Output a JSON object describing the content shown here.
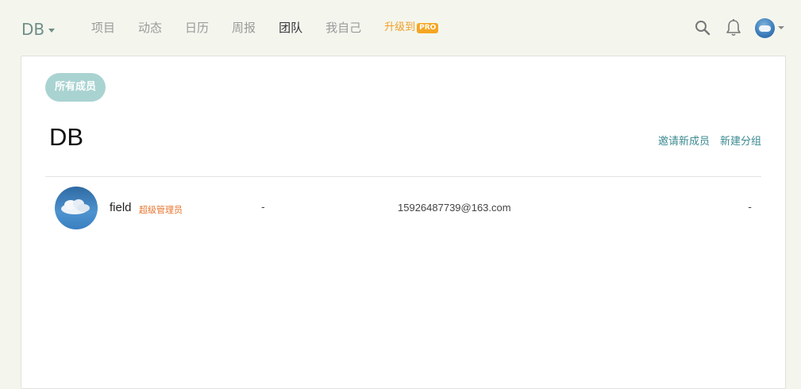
{
  "header": {
    "brand": "DB",
    "nav": [
      {
        "label": "项目",
        "active": false
      },
      {
        "label": "动态",
        "active": false
      },
      {
        "label": "日历",
        "active": false
      },
      {
        "label": "周报",
        "active": false
      },
      {
        "label": "团队",
        "active": true
      },
      {
        "label": "我自己",
        "active": false
      }
    ],
    "upgrade_label": "升级到",
    "pro_badge": "PRO",
    "icons": [
      "search-icon",
      "bell-icon",
      "user-avatar"
    ]
  },
  "team": {
    "filter_chip": "所有成员",
    "title": "DB",
    "invite_label": "邀请新成员",
    "new_group_label": "新建分组"
  },
  "members": [
    {
      "name": "field",
      "role": "超级管理员",
      "col2": "-",
      "email": "15926487739@163.com",
      "col4": "-"
    }
  ],
  "colors": {
    "background": "#f4f6ee",
    "accent": "#3c8a91",
    "chip": "#a9d3d1",
    "role": "#e8742c",
    "upgrade": "#f0a029"
  }
}
